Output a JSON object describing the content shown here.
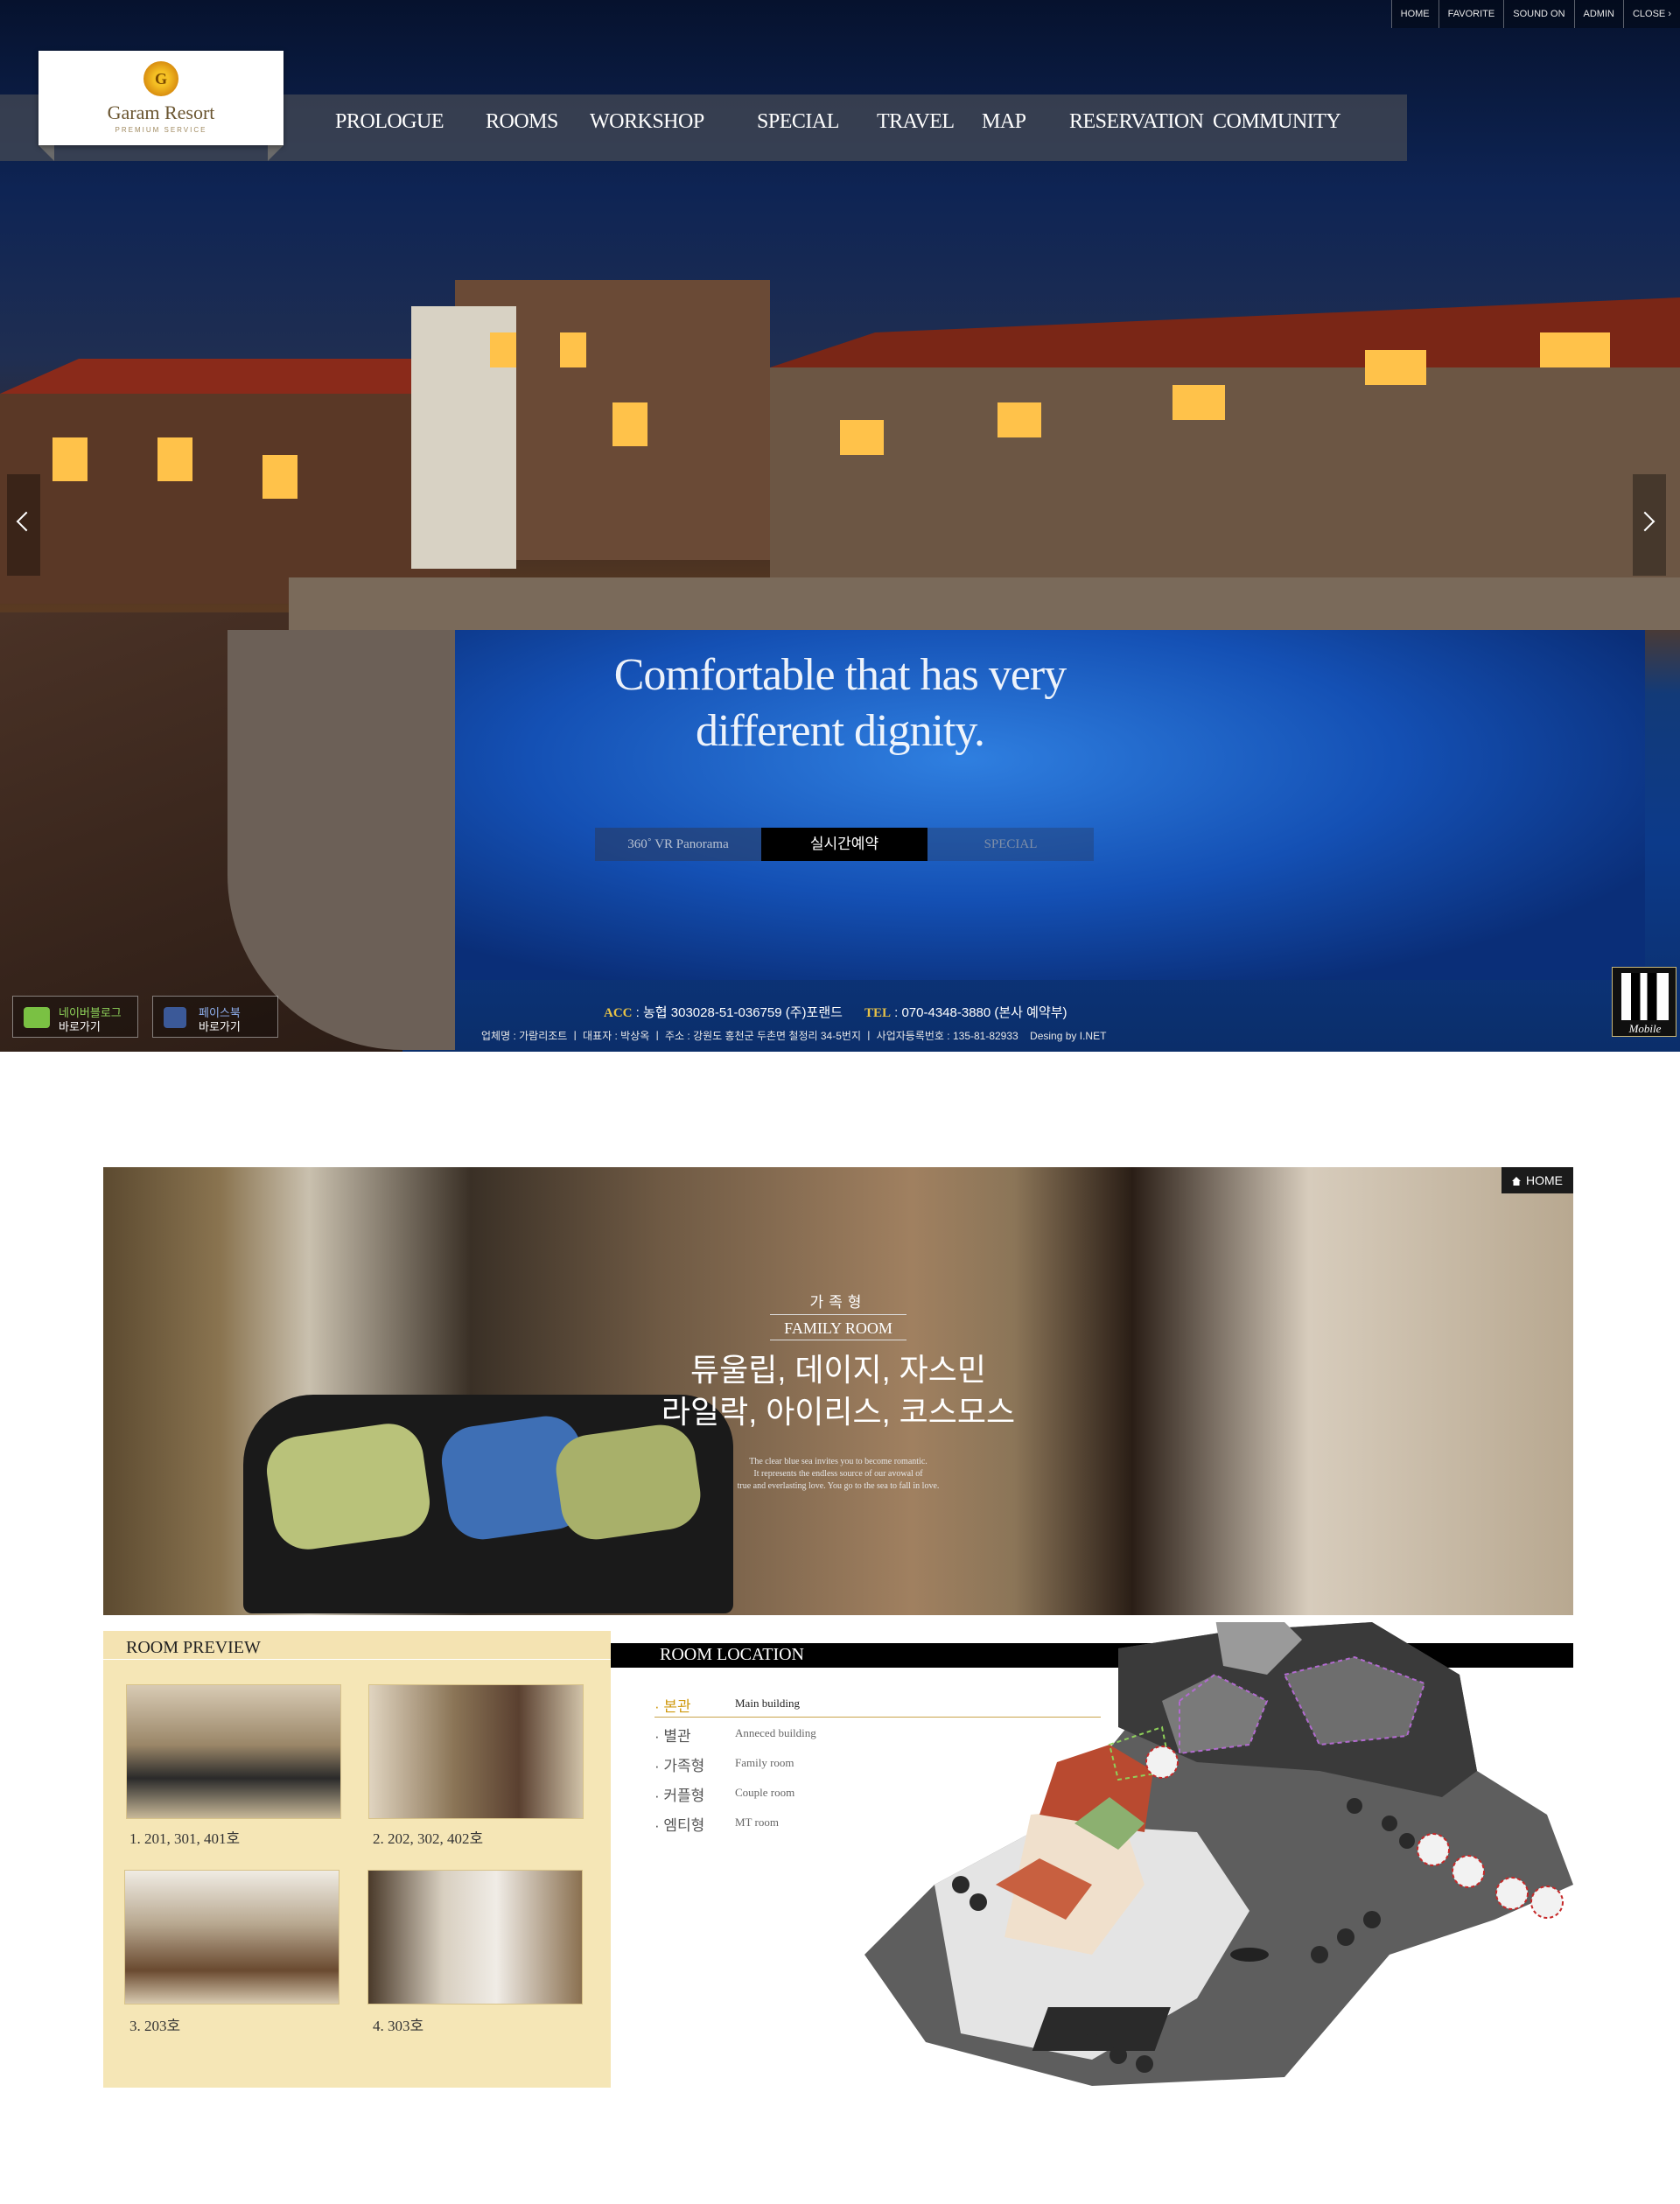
{
  "util_nav": [
    "HOME",
    "FAVORITE",
    "SOUND ON",
    "ADMIN",
    "CLOSE"
  ],
  "logo": {
    "name": "Garam Resort",
    "sub": "PREMIUM SERVICE",
    "emblem": "G"
  },
  "gnb": [
    "PROLOGUE",
    "ROOMS",
    "WORKSHOP",
    "SPECIAL",
    "TRAVEL",
    "MAP",
    "RESERVATION",
    "COMMUNITY"
  ],
  "hero": {
    "headline_line1": "Comfortable that has very",
    "headline_line2": "different dignity.",
    "buttons": {
      "vr": "360˚ VR Panorama",
      "reserve": "실시간예약",
      "special": "SPECIAL"
    }
  },
  "sns": {
    "blog_name": "네이버블로그",
    "blog_go": "바로가기",
    "facebook_name": "페이스북",
    "facebook_go": "바로가기"
  },
  "contact": {
    "acc_label": "ACC",
    "acc_value": ": 농협 303028-51-036759 (주)포랜드",
    "tel_label": "TEL",
    "tel_value": ": 070-4348-3880 (본사 예약부)"
  },
  "company_info": "업체명 : 가람리조트 ㅣ 대표자 : 박상옥 ㅣ 주소 : 강원도 홍천군 두촌면 철정리 34-5번지 ㅣ 사업자등록번호 : 135-81-82933",
  "designer": "Desing by I.NET",
  "qr_label": "Mobile",
  "banner": {
    "home": "HOME",
    "room_kind": "가족형",
    "room_type": "FAMILY ROOM",
    "room_names_line1": "튜울립, 데이지, 자스민",
    "room_names_line2": "라일락, 아이리스, 코스모스",
    "desc_line1": "The clear blue sea invites you to become romantic.",
    "desc_line2": "It represents the endless source of our avowal of",
    "desc_line3": "true and everlasting love. You go to the sea to fall in love."
  },
  "room_preview": {
    "title": "ROOM PREVIEW",
    "items": [
      "1. 201, 301, 401호",
      "2. 202, 302, 402호",
      "3. 203호",
      "4. 303호"
    ]
  },
  "room_location": {
    "title": "ROOM LOCATION",
    "items": [
      {
        "ko": "· 본관",
        "en": "Main building"
      },
      {
        "ko": "· 별관",
        "en": "Anneced building"
      },
      {
        "ko": "· 가족형",
        "en": "Family room"
      },
      {
        "ko": "· 커플형",
        "en": "Couple room"
      },
      {
        "ko": "· 엠티형",
        "en": "MT room"
      }
    ]
  },
  "colors": {
    "accent_gold": "#e7c247",
    "panel_beige": "#f4e3b2",
    "active_item": "#d09a10"
  }
}
